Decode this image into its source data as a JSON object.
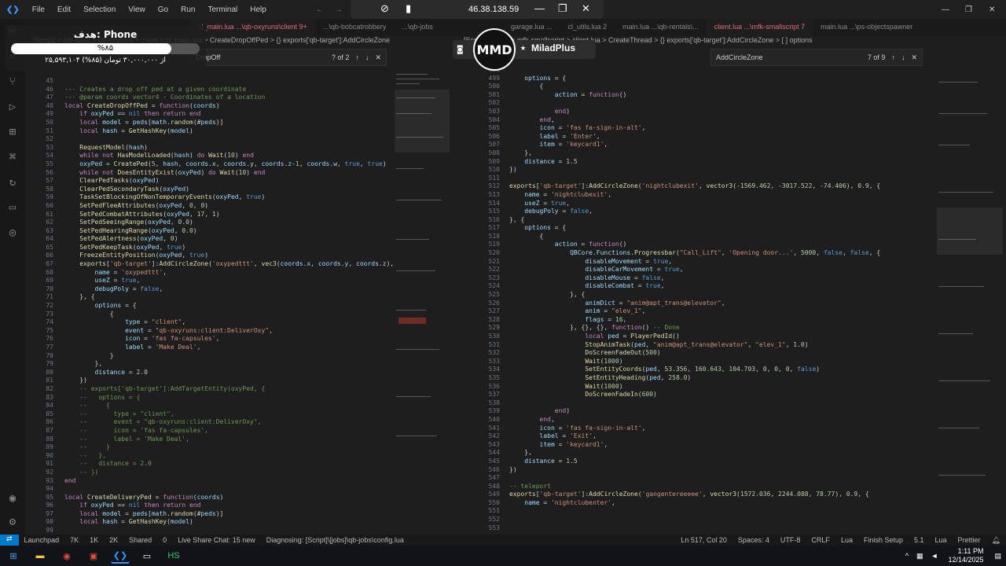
{
  "titlebar": {
    "menus": [
      "File",
      "Edit",
      "Selection",
      "View",
      "Go",
      "Run",
      "Terminal",
      "Help"
    ]
  },
  "rdp": {
    "ip": "46.38.138.59"
  },
  "left_tabs": [
    "cl_main.lua ...\\qb-oxyruns\\client 9+",
    "...\\qb-bobcatrobbery",
    "...\\qb-jobs"
  ],
  "left_breadcrumb": "[Script] > [qb-jobs] > qb-oxyruns > client > cl_main.lua > CreateDropOffPed > {} exports['qb-target']:AddCircleZone",
  "left_find": {
    "query": "DropOff",
    "count": "? of 2"
  },
  "right_tabs": [
    "garage.lua ...",
    "cl_utils.lua 2",
    "main.lua ...\\qb-rentals\\...",
    "client.lua ...\\mfk-smallscript 7",
    "main.lua ...\\ps-objectspawner"
  ],
  "right_breadcrumb": "[Script] > [mfk] > mfk-smallscript > client.lua > CreateThread > {} exports['qb-target']:AddCircleZone > [ ] options",
  "right_find": {
    "query": "AddCircleZone",
    "count": "7 of 9"
  },
  "overlay": {
    "title": "هدف: Phone",
    "percent": "%۸۵",
    "progress_text": "۲۵,۵۹۳,۱۰۴ از ۳۰,۰۰۰,۰۰۰ تومان (۸۵%)",
    "progress": 0.85
  },
  "mmd": {
    "logo": "MMD",
    "name": "MiladPlus"
  },
  "left_code_start": 45,
  "right_code_start": 498,
  "statusbar": {
    "items_left": [
      "Launchpad",
      "7K",
      "1K",
      "2K",
      "Shared",
      "0",
      "Live Share Chat: 15 new",
      "Diagnosing: [Script]\\[jobs]\\qb-jobs\\config.lua"
    ],
    "items_right": [
      "Ln 517, Col 20",
      "Spaces: 4",
      "UTF-8",
      "CRLF",
      "Lua",
      "Finish Setup",
      "5.1",
      "Lua",
      "Prettier"
    ]
  },
  "taskbar": {
    "time": "1:11 PM",
    "date": "12/14/2025"
  },
  "colors": {
    "accent": "#007acc",
    "keyword": "#c586c0",
    "string": "#ce9178",
    "function": "#dcdcaa"
  }
}
